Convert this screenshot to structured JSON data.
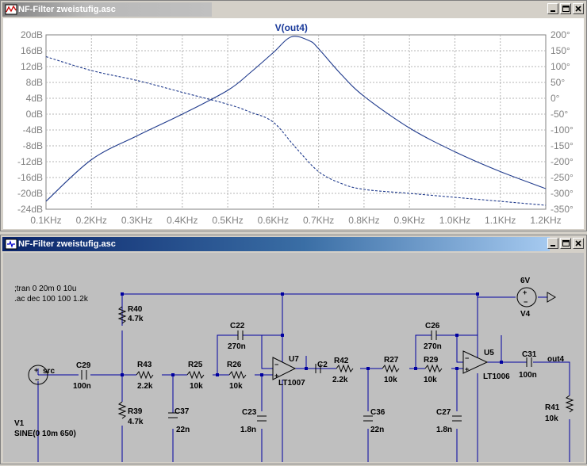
{
  "plot_window": {
    "title": "NF-Filter zweistufig.asc",
    "trace_label": "V(out4)"
  },
  "schematic_window": {
    "title": "NF-Filter zweistufig.asc",
    "directives": [
      ";tran 0 20m 0 10u",
      ".ac dec 100 100 1.2k"
    ],
    "labels": {
      "R40": "R40",
      "R40v": "4.7k",
      "R39": "R39",
      "R39v": "4.7k",
      "R43": "R43",
      "R43v": "2.2k",
      "R25": "R25",
      "R25v": "10k",
      "R26": "R26",
      "R26v": "10k",
      "C22": "C22",
      "C22v": "270n",
      "C37": "C37",
      "C37v": "22n",
      "C23": "C23",
      "C23v": "1.8n",
      "U7": "U7",
      "U7v": "LT1007",
      "C2": "C2",
      "R42": "R42",
      "R42v": "2.2k",
      "R27": "R27",
      "R27v": "10k",
      "R29": "R29",
      "R29v": "10k",
      "C26": "C26",
      "C26v": "270n",
      "C36": "C36",
      "C36v": "22n",
      "C27": "C27",
      "C27v": "1.8n",
      "U5": "U5",
      "U5v": "LT1006",
      "C31": "C31",
      "C31v": "100n",
      "out4": "out4",
      "R41": "R41",
      "R41v": "10k",
      "C29": "C29",
      "C29v": "100n",
      "src": "src",
      "V1": "V1",
      "V1v": "SINE(0 10m 650)",
      "V4v": "6V",
      "V4": "V4"
    }
  },
  "chart_data": {
    "type": "line",
    "title": "V(out4)",
    "x_ticks": [
      "0.1KHz",
      "0.2KHz",
      "0.3KHz",
      "0.4KHz",
      "0.5KHz",
      "0.6KHz",
      "0.7KHz",
      "0.8KHz",
      "0.9KHz",
      "1.0KHz",
      "1.1KHz",
      "1.2KHz"
    ],
    "y_left_ticks": [
      "20dB",
      "16dB",
      "12dB",
      "8dB",
      "4dB",
      "0dB",
      "-4dB",
      "-8dB",
      "-12dB",
      "-16dB",
      "-20dB",
      "-24dB"
    ],
    "y_right_ticks": [
      "200°",
      "150°",
      "100°",
      "50°",
      "0°",
      "-50°",
      "-100°",
      "-150°",
      "-200°",
      "-250°",
      "-300°",
      "-350°"
    ],
    "xlim": [
      100,
      1200
    ],
    "ylim_left": [
      -24,
      20
    ],
    "ylim_right": [
      -350,
      200
    ],
    "grid": true,
    "series": [
      {
        "style": "solid",
        "axis": "left",
        "x": [
          100,
          200,
          300,
          400,
          500,
          550,
          600,
          640,
          680,
          700,
          750,
          800,
          900,
          1000,
          1100,
          1200
        ],
        "y": [
          -22,
          -11.5,
          -5.5,
          0,
          6,
          10.5,
          15.5,
          19.5,
          18.5,
          16.5,
          10,
          4.5,
          -3.5,
          -9.5,
          -14.5,
          -18.8
        ]
      },
      {
        "style": "dashed",
        "axis": "left",
        "x": [
          100,
          200,
          300,
          400,
          500,
          550,
          600,
          650,
          700,
          750,
          800,
          900,
          1000,
          1100,
          1200
        ],
        "y": [
          14.5,
          11,
          8.5,
          5.5,
          2.5,
          0.5,
          -2,
          -8.5,
          -14.5,
          -17.5,
          -19,
          -20,
          -21,
          -22,
          -23
        ]
      }
    ]
  }
}
